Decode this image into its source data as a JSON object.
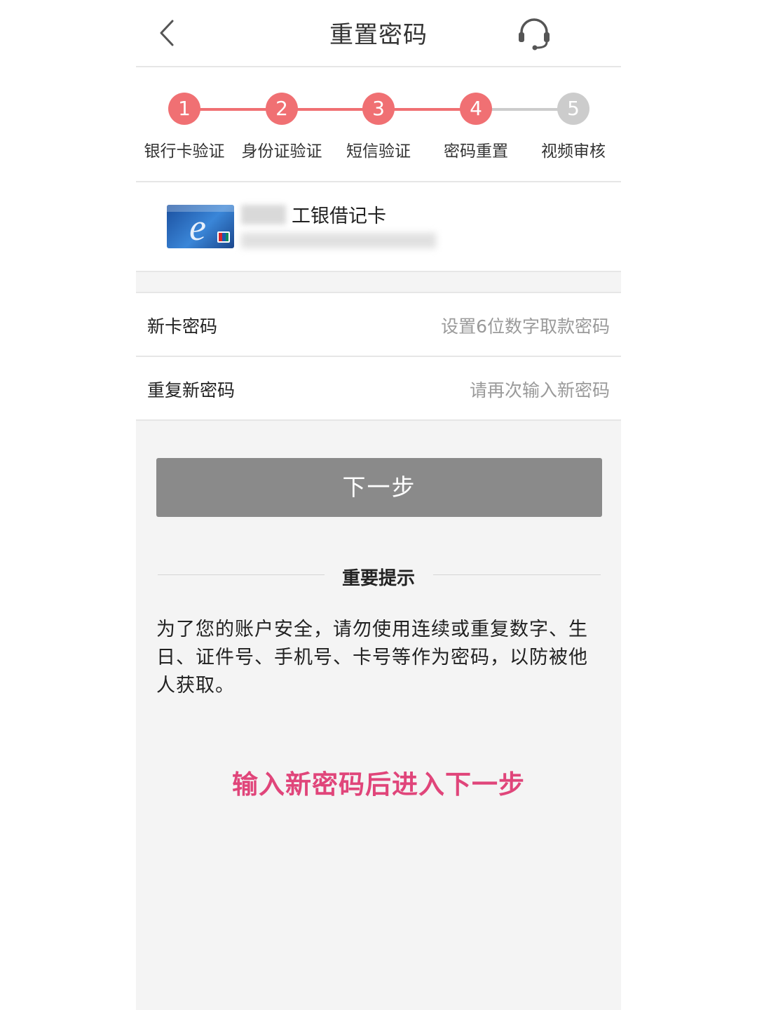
{
  "header": {
    "title": "重置密码",
    "back_icon": "chevron-left-icon",
    "support_icon": "headset-icon"
  },
  "steps": [
    {
      "num": "1",
      "label": "银行卡验证",
      "state": "done"
    },
    {
      "num": "2",
      "label": "身份证验证",
      "state": "done"
    },
    {
      "num": "3",
      "label": "短信验证",
      "state": "done"
    },
    {
      "num": "4",
      "label": "密码重置",
      "state": "current"
    },
    {
      "num": "5",
      "label": "视频审核",
      "state": "pending"
    }
  ],
  "colors": {
    "active": "#f07073",
    "inactive": "#cccccc",
    "hint": "#e0457a",
    "button": "#8a8a8a"
  },
  "card": {
    "name": "工银借记卡"
  },
  "form": {
    "new_pin_label": "新卡密码",
    "new_pin_placeholder": "设置6位数字取款密码",
    "repeat_pin_label": "重复新密码",
    "repeat_pin_placeholder": "请再次输入新密码"
  },
  "next_button": "下一步",
  "notice": {
    "title": "重要提示",
    "text": "为了您的账户安全，请勿使用连续或重复数字、生日、证件号、手机号、卡号等作为密码，以防被他人获取。"
  },
  "annotation": "输入新密码后进入下一步"
}
